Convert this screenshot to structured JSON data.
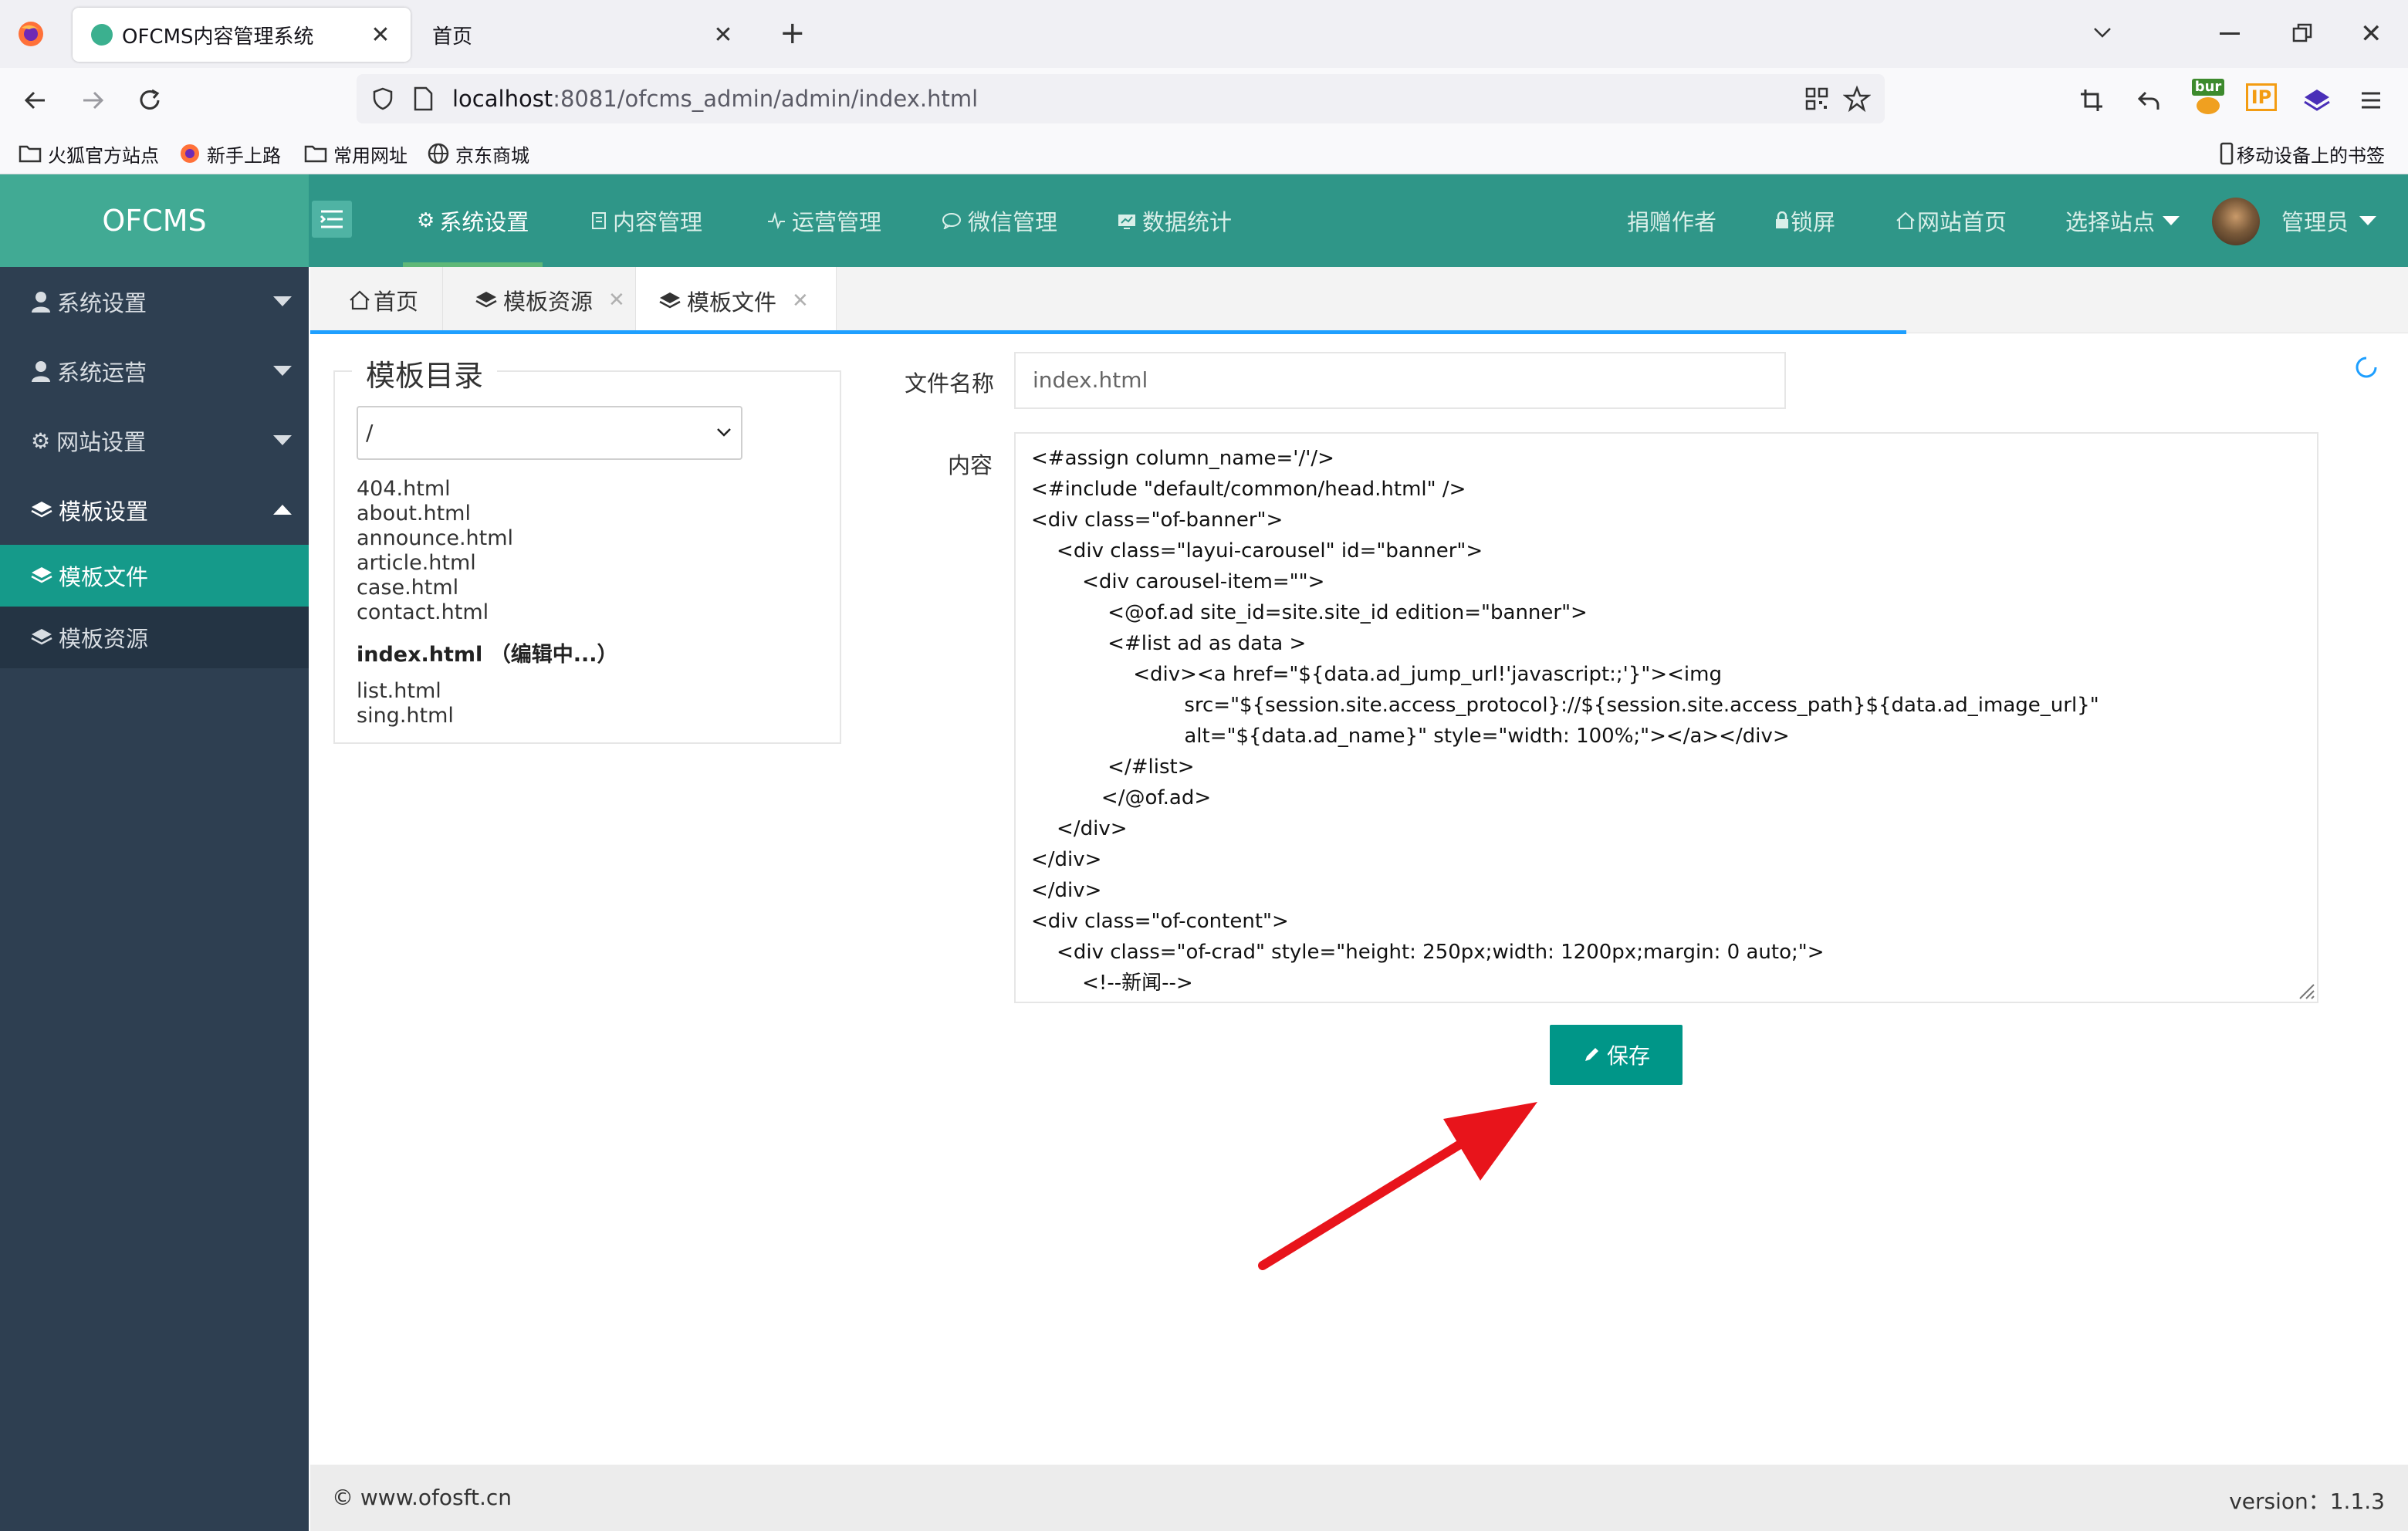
{
  "browser": {
    "tabs": [
      {
        "title": "OFCMS内容管理系统",
        "active": true
      },
      {
        "title": "首页",
        "active": false
      }
    ],
    "url": {
      "host": "localhost",
      "rest": ":8081/ofcms_admin/admin/index.html"
    },
    "bookmarks": [
      "火狐官方站点",
      "新手上路",
      "常用网址",
      "京东商城"
    ],
    "mobile_bookmarks": "移动设备上的书签",
    "ext_labels": {
      "bur": "bur",
      "ip": "IP"
    }
  },
  "app": {
    "logo": "OFCMS",
    "nav": [
      {
        "label": "系统设置",
        "icon": "gear-icon"
      },
      {
        "label": "内容管理",
        "icon": "document-icon"
      },
      {
        "label": "运营管理",
        "icon": "pulse-icon"
      },
      {
        "label": "微信管理",
        "icon": "chat-icon"
      },
      {
        "label": "数据统计",
        "icon": "chart-icon"
      }
    ],
    "right_nav": {
      "donate": "捐赠作者",
      "lock": "锁屏",
      "site_home": "网站首页",
      "select_site": "选择站点",
      "user": "管理员"
    }
  },
  "sidebar": {
    "items": [
      {
        "label": "系统设置",
        "expanded": false
      },
      {
        "label": "系统运营",
        "expanded": false
      },
      {
        "label": "网站设置",
        "expanded": false
      },
      {
        "label": "模板设置",
        "expanded": true
      }
    ],
    "subitems": [
      {
        "label": "模板文件",
        "active": true
      },
      {
        "label": "模板资源",
        "active": false
      }
    ]
  },
  "page_tabs": [
    {
      "label": "首页"
    },
    {
      "label": "模板资源"
    },
    {
      "label": "模板文件",
      "active": true
    }
  ],
  "dir_panel": {
    "title": "模板目录",
    "select_value": "/",
    "files": [
      "404.html",
      "about.html",
      "announce.html",
      "article.html",
      "case.html",
      "contact.html"
    ],
    "current_file": "index.html （编辑中...）",
    "files_after": [
      "list.html",
      "sing.html"
    ]
  },
  "form": {
    "filename_label": "文件名称",
    "filename_value": "index.html",
    "content_label": "内容",
    "content_lines": [
      "<#assign column_name='/'/>",
      "<#include \"default/common/head.html\" />",
      "<div class=\"of-banner\">",
      "    <div class=\"layui-carousel\" id=\"banner\">",
      "        <div carousel-item=\"\">",
      "            <@of.ad site_id=site.site_id edition=\"banner\">",
      "            <#list ad as data >",
      "                <div><a href=\"${data.ad_jump_url!'javascript:;'}\"><img",
      "                        src=\"${session.site.access_protocol}://${session.site.access_path}${data.ad_image_url}\"",
      "                        alt=\"${data.ad_name}\" style=\"width: 100%;\"></a></div>",
      "            </#list>",
      "           </@of.ad>",
      "    </div>",
      "</div>",
      "</div>",
      "<div class=\"of-content\">",
      "    <div class=\"of-crad\" style=\"height: 250px;width: 1200px;margin: 0 auto;\">",
      "        <!--新闻-->"
    ],
    "save_label": "保存"
  },
  "footer": {
    "copyright": "© www.ofosft.cn",
    "version": "version：1.1.3"
  },
  "colors": {
    "header": "#2f9688",
    "sidebar": "#2e3f51",
    "accent": "#009688",
    "annotation_arrow": "#e8141b"
  }
}
